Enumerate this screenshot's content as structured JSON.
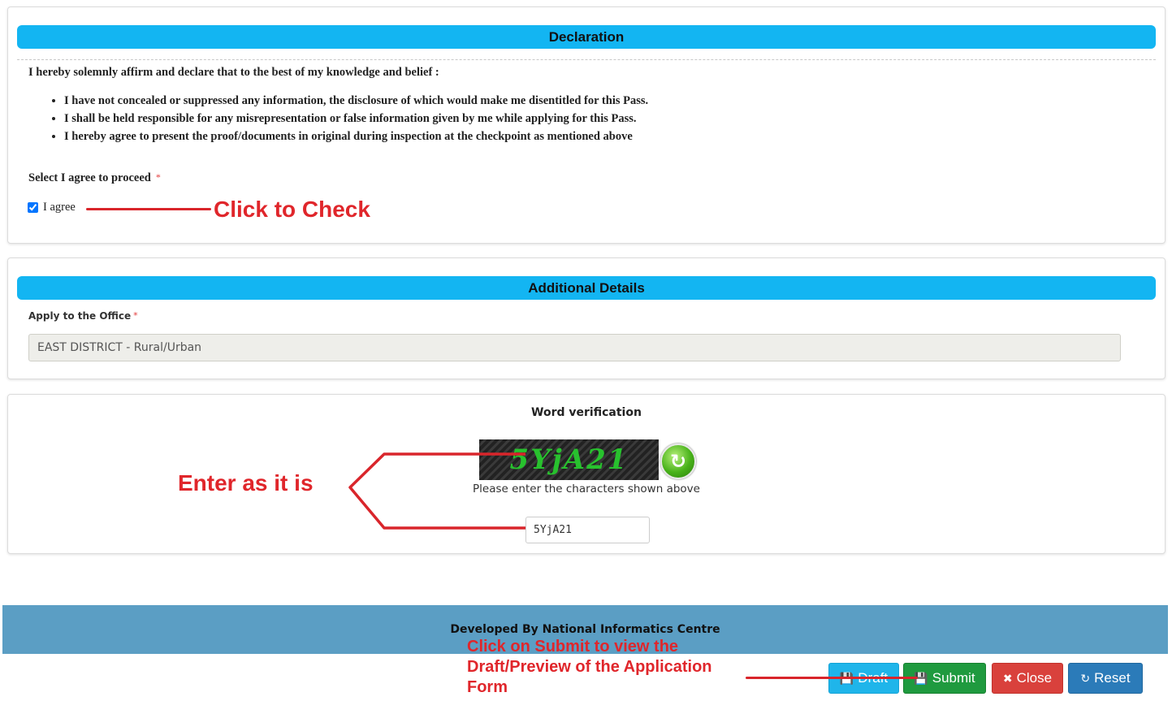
{
  "declaration": {
    "header": "Declaration",
    "intro": "I hereby solemnly affirm and declare that to the best of my knowledge and belief :",
    "points": [
      "I have not concealed or suppressed any information, the disclosure of which would make me disentitled for this Pass.",
      "I shall be held responsible for any misrepresentation or false information given by me while applying for this Pass.",
      "I hereby agree to present the proof/documents in original during inspection at the checkpoint as mentioned above"
    ],
    "agree_prompt": "Select I agree to proceed",
    "required_mark": "*",
    "agree_label": "I agree",
    "agree_checked": true
  },
  "additional": {
    "header": "Additional Details",
    "office_label": "Apply to the Office",
    "required_mark": "*",
    "office_value": "EAST DISTRICT  - Rural/Urban"
  },
  "verification": {
    "title": "Word verification",
    "captcha_text": "5YjA21",
    "hint": "Please enter the characters shown above",
    "input_value": "5YjA21"
  },
  "footer": {
    "credit": "Developed By National Informatics Centre"
  },
  "buttons": {
    "draft": "Draft",
    "submit": "Submit",
    "close": "Close",
    "reset": "Reset"
  },
  "annotations": {
    "check": "Click to Check",
    "enter": "Enter as it is",
    "submit_line1": "Click on Submit to view the",
    "submit_line2": "Draft/Preview of the Application",
    "submit_line3": "Form"
  },
  "colors": {
    "header_bg": "#13b5f2",
    "footer_bg": "#5b9ec4",
    "draft": "#1fb5ea",
    "submit": "#1f9a3f",
    "close": "#d9413c",
    "reset": "#2b7bb9",
    "annotation": "#e0262b"
  },
  "icons": {
    "draft": "floppy-disk-icon",
    "submit": "floppy-disk-icon",
    "close": "close-circle-icon",
    "reset": "refresh-icon",
    "captcha_refresh": "refresh-icon"
  }
}
